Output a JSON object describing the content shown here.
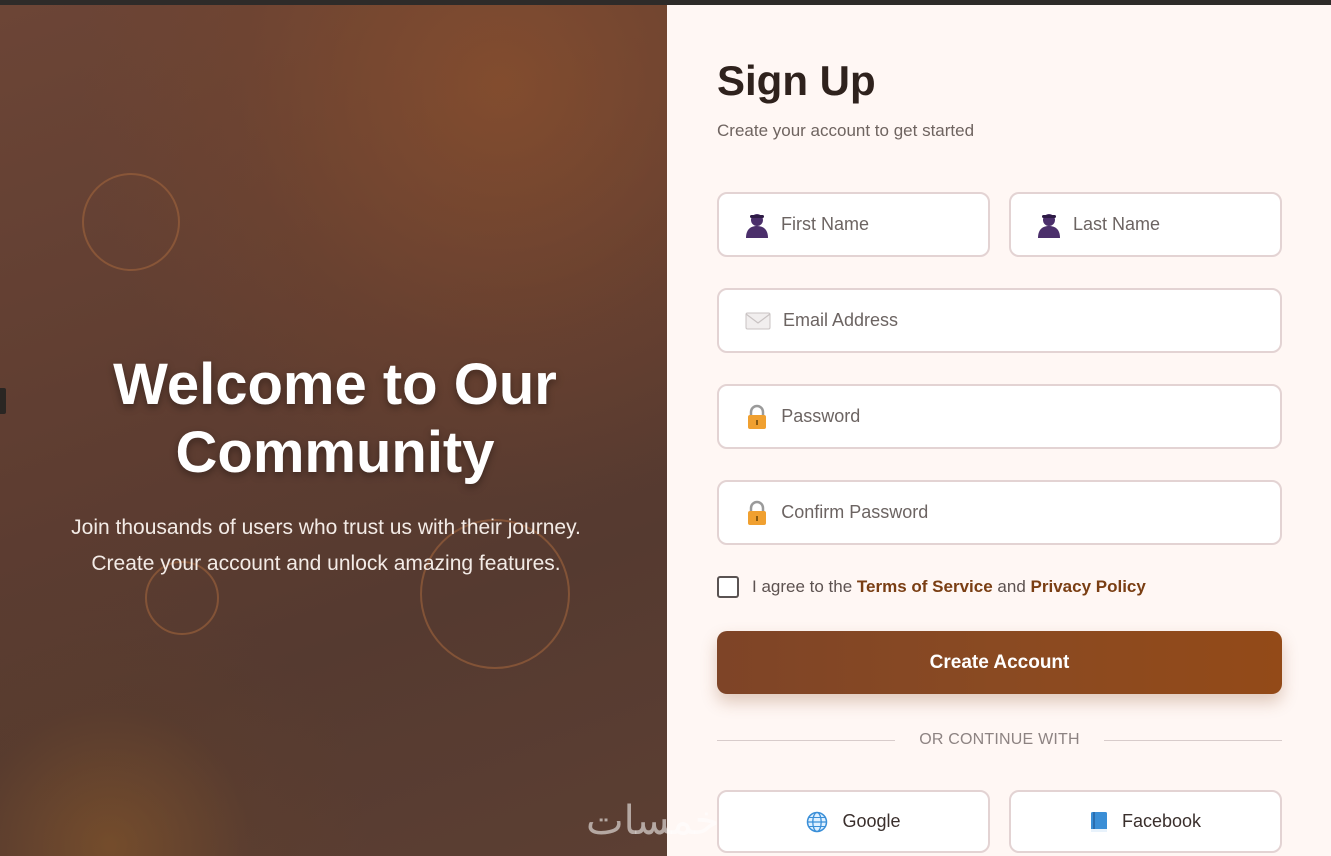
{
  "hero": {
    "title": "Welcome to Our Community",
    "text": "Join thousands of users who trust us with their journey. Create your account and unlock amazing features."
  },
  "form": {
    "title": "Sign Up",
    "subtitle": "Create your account to get started",
    "first_name_placeholder": "First Name",
    "last_name_placeholder": "Last Name",
    "email_placeholder": "Email Address",
    "password_placeholder": "Password",
    "confirm_password_placeholder": "Confirm Password",
    "agree_prefix": "I agree to the",
    "terms_label": "Terms of Service",
    "agree_and": "and",
    "privacy_label": "Privacy Policy",
    "agree_checked": false,
    "submit_label": "Create Account",
    "divider_text": "OR CONTINUE WITH"
  },
  "social": {
    "google_label": "Google",
    "facebook_label": "Facebook"
  },
  "icons": {
    "first_name": "user-icon",
    "last_name": "user-icon",
    "email": "envelope-icon",
    "password": "lock-icon",
    "confirm_password": "lock-icon",
    "google": "globe-icon",
    "facebook": "book-icon"
  },
  "watermark": "خمسات",
  "colors": {
    "accent": "#8a4a22",
    "link": "#7a3e13",
    "panel_bg": "#fff7f4",
    "hero_bg": "#5e3d31"
  }
}
